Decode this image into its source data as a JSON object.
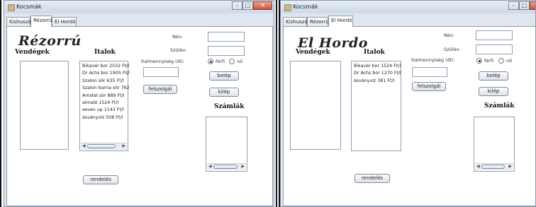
{
  "windows": [
    {
      "title": "Kocsmák",
      "tabs": [
        "Kishuszár",
        "Rézorrú",
        "El Hordó"
      ],
      "active_tab": "Rézorrú",
      "pub_title": "Rézorrú",
      "guests_label": "Vendégek",
      "drinks_label": "Italok",
      "drinks": [
        "Bikavér bor 2032 Ft/l",
        "Dr Achs bor 1905 Ft/l",
        "Szalon sör 635 Ft/l",
        "Szalon barna sör 762",
        "Amstel sör 889 Ft/l",
        "almalé 1524 Ft/l",
        "seven up 1143 Ft/l",
        "ásványvíz 508 Ft/l"
      ],
      "name_label": "Név:",
      "birth_label": "Szülév:",
      "amount_label": "Italmennyiség (dl):",
      "male_label": "férfi",
      "female_label": "nő",
      "gender_selected": "férfi",
      "enter_button": "belép",
      "exit_button": "kilép",
      "serve_button": "felszolgál",
      "bills_label": "Számlák",
      "order_button": "rendelés"
    },
    {
      "title": "Kocsmák",
      "tabs": [
        "Kishuszár",
        "Rézorrú",
        "El Hordó"
      ],
      "active_tab": "El Hordó",
      "pub_title": "El Hordo",
      "guests_label": "Vendégek",
      "drinks_label": "Italok",
      "drinks": [
        "Bikavér bor 1524 Ft/l",
        "Dr Achs bor 1270 Ft/l",
        "ásványvíz 381 Ft/l"
      ],
      "name_label": "Név:",
      "birth_label": "Szülév:",
      "amount_label": "Italmennyiség (dl):",
      "male_label": "férfi",
      "female_label": "nő",
      "gender_selected": "férfi",
      "enter_button": "belép",
      "exit_button": "kilép",
      "serve_button": "felszolgál",
      "bills_label": "Számlák",
      "order_button": "rendelés"
    }
  ]
}
